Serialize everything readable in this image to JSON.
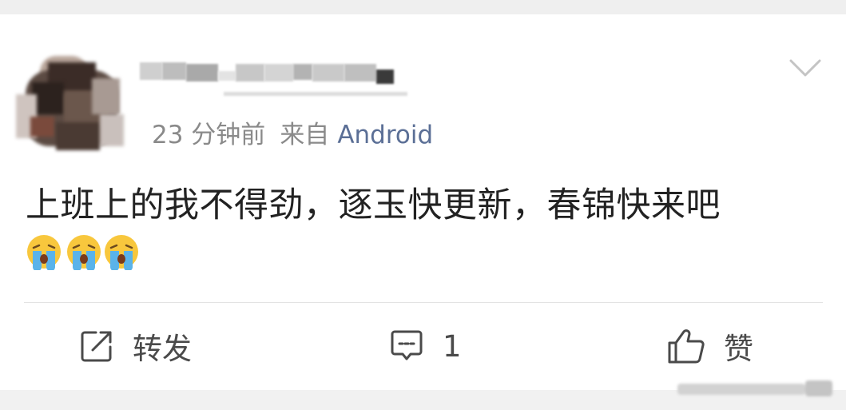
{
  "post": {
    "author": {
      "avatar_icon": "user-avatar-blurred",
      "username_redacted": true
    },
    "meta": {
      "time": "23 分钟前",
      "from_label": "来自",
      "source": "Android"
    },
    "text": "上班上的我不得劲，逐玉快更新，春锦快来吧",
    "emojis": [
      "crying-face-emoji",
      "crying-face-emoji",
      "crying-face-emoji"
    ],
    "menu_icon": "chevron-down-icon"
  },
  "actions": {
    "repost": {
      "icon": "share-icon",
      "label": "转发"
    },
    "comment": {
      "icon": "comment-icon",
      "count": "1"
    },
    "like": {
      "icon": "thumbs-up-icon",
      "label": "赞"
    }
  },
  "colors": {
    "text": "#222222",
    "meta": "#8a8a8a",
    "source_link": "#5b6f96",
    "background": "#efefef",
    "card": "#ffffff"
  }
}
